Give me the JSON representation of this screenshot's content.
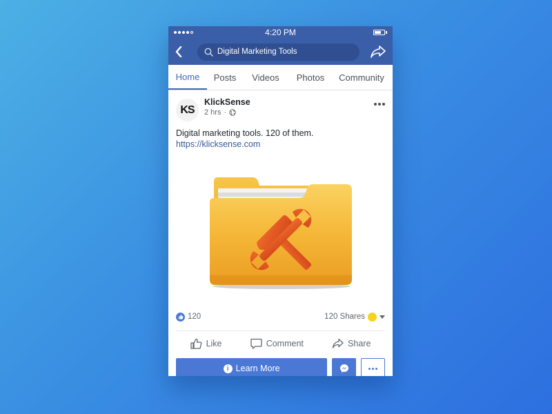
{
  "status_bar": {
    "time": "4:20 PM"
  },
  "search": {
    "value": "Digital Marketing Tools"
  },
  "tabs": [
    {
      "label": "Home",
      "active": true
    },
    {
      "label": "Posts"
    },
    {
      "label": "Videos"
    },
    {
      "label": "Photos"
    },
    {
      "label": "Community"
    }
  ],
  "post": {
    "avatar_initials": "KS",
    "author": "KlickSense",
    "timestamp": "2 hrs",
    "meta_separator": "·",
    "text": "Digital marketing tools. 120 of them.",
    "link": "https://klicksense.com",
    "image_icon": "folder-with-tools-icon"
  },
  "counts": {
    "likes": "120",
    "shares": "120 Shares"
  },
  "actions": {
    "like": "Like",
    "comment": "Comment",
    "share": "Share"
  },
  "cta": {
    "learn_more": "Learn More"
  },
  "colors": {
    "brand": "#3b5ea8",
    "accent": "#4a78d4",
    "link": "#385898",
    "folder": "#f4b233",
    "tools": "#e0551f"
  }
}
